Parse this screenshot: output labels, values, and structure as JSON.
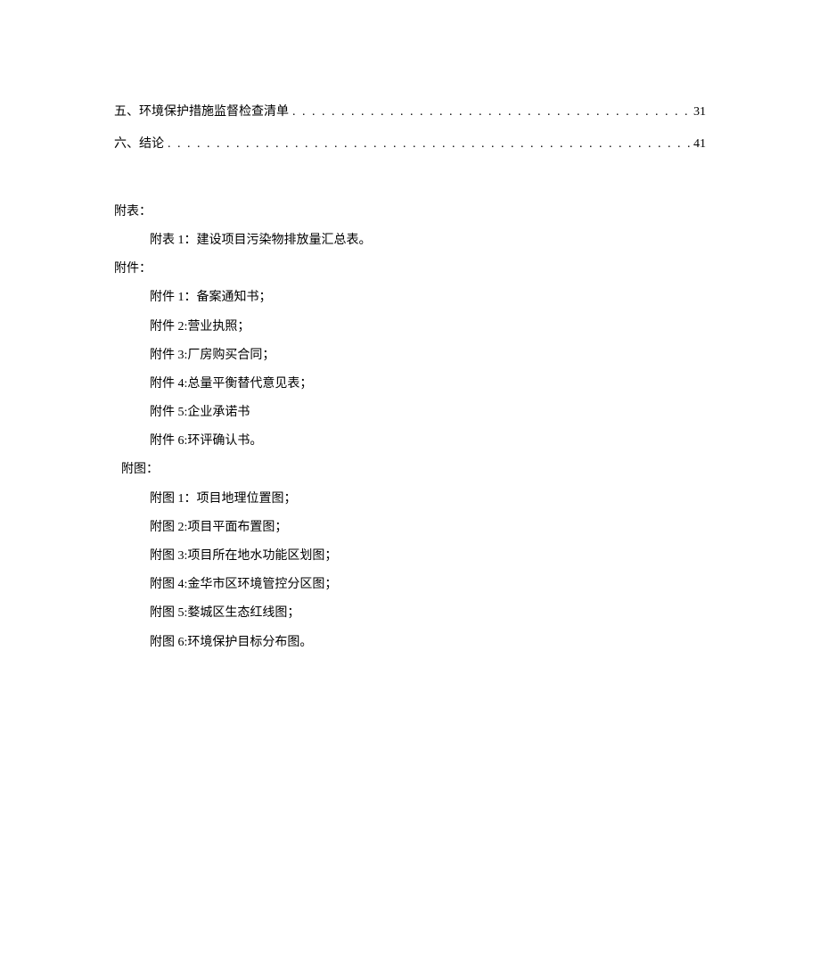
{
  "toc": [
    {
      "title": "五、环境保护措施监督检查清单",
      "page": "31"
    },
    {
      "title": "六、结论",
      "page": "41"
    }
  ],
  "toc_dots": ". . . . . . . . . . . . . . . . . . . . . . . . . . . . . . . . . . . . . . . . . . . . . . . . . . . . . . . . . . . . . . . . . . . . . . . . . . . . . . . . . . . . . . . . . . . . . . . . . . . . . . . . . . . . . . . . . . . . . . . .",
  "sections": {
    "fubiao_heading": "附表：",
    "fubiao_items": [
      "附表 1：建设项目污染物排放量汇总表。"
    ],
    "fujian_heading": "附件：",
    "fujian_items": [
      "附件 1：备案通知书；",
      "附件 2:营业执照；",
      "附件 3:厂房购买合同；",
      "附件 4:总量平衡替代意见表；",
      "附件 5:企业承诺书",
      "附件 6:环评确认书。"
    ],
    "futu_heading": "附图：",
    "futu_items": [
      "附图 1：项目地理位置图；",
      "附图 2:项目平面布置图；",
      "附图 3:项目所在地水功能区划图；",
      "附图 4:金华市区环境管控分区图；",
      "附图 5:婺城区生态红线图；",
      "附图 6:环境保护目标分布图。"
    ]
  }
}
